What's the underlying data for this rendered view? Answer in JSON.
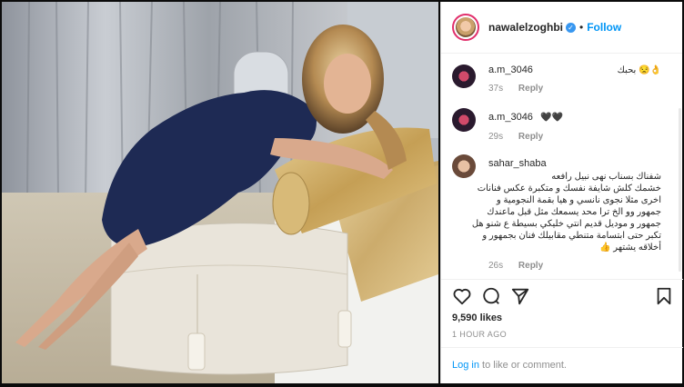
{
  "header": {
    "username": "nawalelzoghbi",
    "verified_icon": "verified-badge-icon",
    "separator": "•",
    "follow_label": "Follow"
  },
  "comments": [
    {
      "user": "a.m_3046",
      "text": "👌😒 بحبك",
      "time": "37s",
      "reply": "Reply"
    },
    {
      "user": "a.m_3046",
      "text": "🖤🖤",
      "time": "29s",
      "reply": "Reply"
    },
    {
      "user": "sahar_shaba",
      "lines": [
        "شفناك بسناب نهى نبيل رافعه",
        "خشمك كلش شايفة نفسك و متكبرة عكس فنانات",
        "اخرى مثلا نجوى نانسي و هيا بقمة النجومية و",
        "جمهور وو الخ ترا محد يسمعك مثل قبل ماعندك",
        "جمهور و موديل قديم انتي خليكي بسيطة ع شنو هل",
        "تكبر حتى ابتسامة متنطي مقابيلك فنان بجمهور و",
        "أخلاقه يشتهر 👍"
      ],
      "time": "26s",
      "reply": "Reply"
    }
  ],
  "actions": {
    "like_icon": "heart-icon",
    "comment_icon": "comment-bubble-icon",
    "share_icon": "paper-plane-icon",
    "save_icon": "bookmark-icon"
  },
  "likes": "9,590 likes",
  "time_ago": "1 HOUR AGO",
  "login": {
    "link": "Log in",
    "rest": " to like or comment."
  },
  "colors": {
    "link_blue": "#0095f6",
    "verified_blue": "#3897f0",
    "text": "#262626",
    "muted": "#8e8e8e"
  }
}
